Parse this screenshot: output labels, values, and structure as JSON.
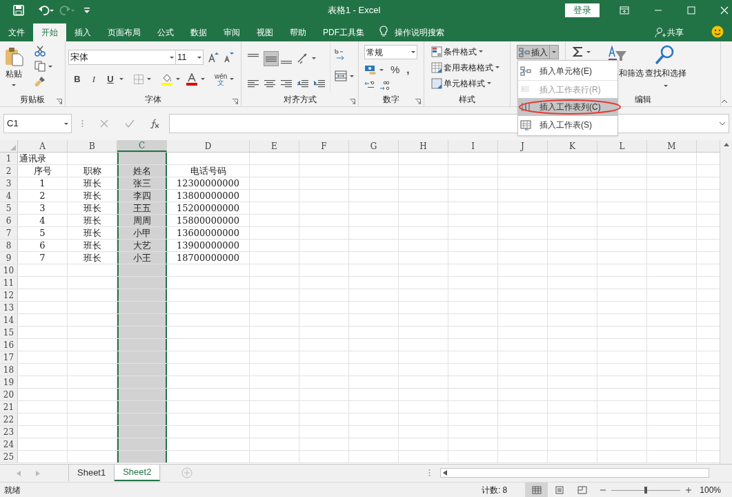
{
  "window": {
    "title": "表格1  -  Excel",
    "sign_in": "登录"
  },
  "tabs": [
    {
      "label": "文件",
      "selected": false
    },
    {
      "label": "开始",
      "selected": true
    },
    {
      "label": "插入",
      "selected": false
    },
    {
      "label": "页面布局",
      "selected": false
    },
    {
      "label": "公式",
      "selected": false
    },
    {
      "label": "数据",
      "selected": false
    },
    {
      "label": "审阅",
      "selected": false
    },
    {
      "label": "视图",
      "selected": false
    },
    {
      "label": "帮助",
      "selected": false
    },
    {
      "label": "PDF工具集",
      "selected": false
    }
  ],
  "tell_me": "操作说明搜索",
  "share": "共享",
  "ribbon": {
    "clipboard": {
      "paste": "粘贴",
      "label": "剪贴板"
    },
    "font": {
      "name": "宋体",
      "size": "11",
      "bold": "B",
      "italic": "I",
      "underline": "U",
      "phonetic_top": "wén",
      "phonetic_bottom": "文",
      "label": "字体"
    },
    "alignment": {
      "label": "对齐方式"
    },
    "number": {
      "format": "常规",
      "percent": "%",
      "comma": ",",
      "label": "数字"
    },
    "styles": {
      "items": [
        "条件格式",
        "套用表格格式",
        "单元格样式"
      ],
      "label": "样式"
    },
    "cells": {
      "insert": "插入"
    },
    "editing": {
      "sort_filter": "和筛选",
      "find_select": "查找和选择",
      "label": "编辑"
    }
  },
  "insert_menu": [
    {
      "label": "插入单元格(E)",
      "disabled": false,
      "selected": false,
      "circled": false
    },
    {
      "label": "插入工作表行(R)",
      "disabled": true,
      "selected": false,
      "circled": false
    },
    {
      "label": "插入工作表列(C)",
      "disabled": false,
      "selected": true,
      "circled": true
    },
    {
      "label": "插入工作表(S)",
      "disabled": false,
      "selected": false,
      "circled": false
    }
  ],
  "formula_bar": {
    "name_box": "C1"
  },
  "sheet": {
    "columns": [
      {
        "label": "A",
        "selected": false
      },
      {
        "label": "B",
        "selected": false
      },
      {
        "label": "C",
        "selected": true
      },
      {
        "label": "D",
        "selected": false
      },
      {
        "label": "E",
        "selected": false
      },
      {
        "label": "F",
        "selected": false
      },
      {
        "label": "G",
        "selected": false
      },
      {
        "label": "H",
        "selected": false
      },
      {
        "label": "I",
        "selected": false
      },
      {
        "label": "J",
        "selected": false
      },
      {
        "label": "K",
        "selected": false
      },
      {
        "label": "L",
        "selected": false
      },
      {
        "label": "M",
        "selected": false
      }
    ],
    "row_numbers": [
      "1",
      "2",
      "3",
      "4",
      "5",
      "6",
      "7",
      "8",
      "9",
      "10",
      "11",
      "12",
      "13",
      "14",
      "15",
      "16",
      "17",
      "18",
      "19",
      "20",
      "21",
      "22",
      "23",
      "24",
      "25"
    ],
    "title_cell": "通讯录",
    "rows": [
      [
        "序号",
        "职称",
        "姓名",
        "电话号码"
      ],
      [
        "1",
        "班长",
        "张三",
        "12300000000"
      ],
      [
        "2",
        "班长",
        "李四",
        "13800000000"
      ],
      [
        "3",
        "班长",
        "王五",
        "15200000000"
      ],
      [
        "4",
        "班长",
        "周周",
        "15800000000"
      ],
      [
        "5",
        "班长",
        "小甲",
        "13600000000"
      ],
      [
        "6",
        "班长",
        "大艺",
        "13900000000"
      ],
      [
        "7",
        "班长",
        "小王",
        "18700000000"
      ]
    ]
  },
  "sheet_tabs": [
    {
      "label": "Sheet1",
      "selected": false
    },
    {
      "label": "Sheet2",
      "selected": true
    }
  ],
  "status_bar": {
    "ready": "就绪",
    "count": "计数: 8",
    "views": [
      {
        "selected": true
      },
      {
        "selected": false
      },
      {
        "selected": false
      }
    ],
    "zoom": "100%",
    "level": 0.5
  }
}
